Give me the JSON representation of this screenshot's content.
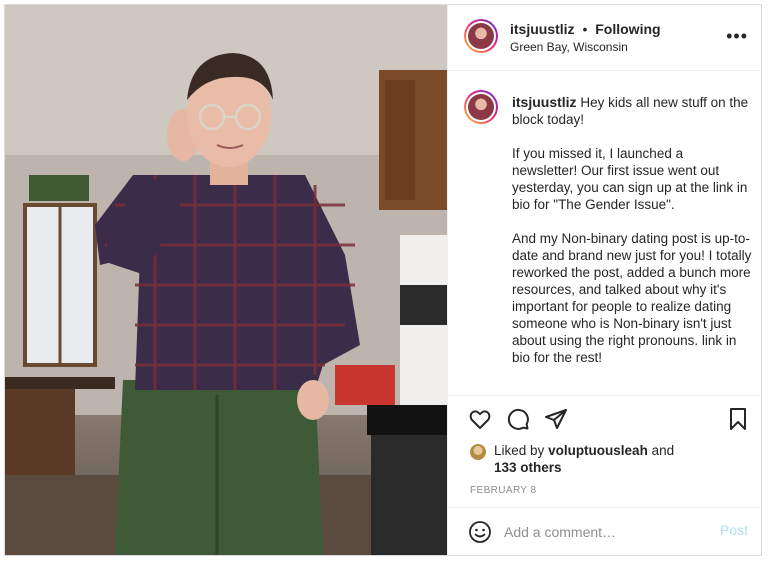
{
  "post": {
    "username": "itsjuustliz",
    "separator": "•",
    "follow_status": "Following",
    "location": "Green Bay, Wisconsin",
    "more_icon": "more-horizontal-icon",
    "caption": "Hey kids all new stuff on the block today!\n\nIf you missed it, I launched a newsletter! Our first issue went out yesterday, you can sign up at the link in bio for \"The Gender Issue\".\n\nAnd my Non-binary dating post is up-to-date and brand new just for you! I totally reworked the post, added a bunch more resources, and talked about why it's important for people to realize dating someone who is Non-binary isn't just about using the right pronouns. link in bio for the rest!",
    "likes": {
      "prefix": "Liked by",
      "user": "voluptuousleah",
      "conjunction": "and",
      "others": "133 others"
    },
    "date": "FEBRUARY 8",
    "comment_placeholder": "Add a comment…",
    "post_button": "Post"
  },
  "icons": [
    "heart-icon",
    "comment-icon",
    "share-icon",
    "bookmark-icon",
    "emoji-icon"
  ],
  "colors": {
    "text": "#262626",
    "muted": "#8e8e8e",
    "post_button_disabled": "#b2dffc",
    "border": "#dbdbdb"
  }
}
